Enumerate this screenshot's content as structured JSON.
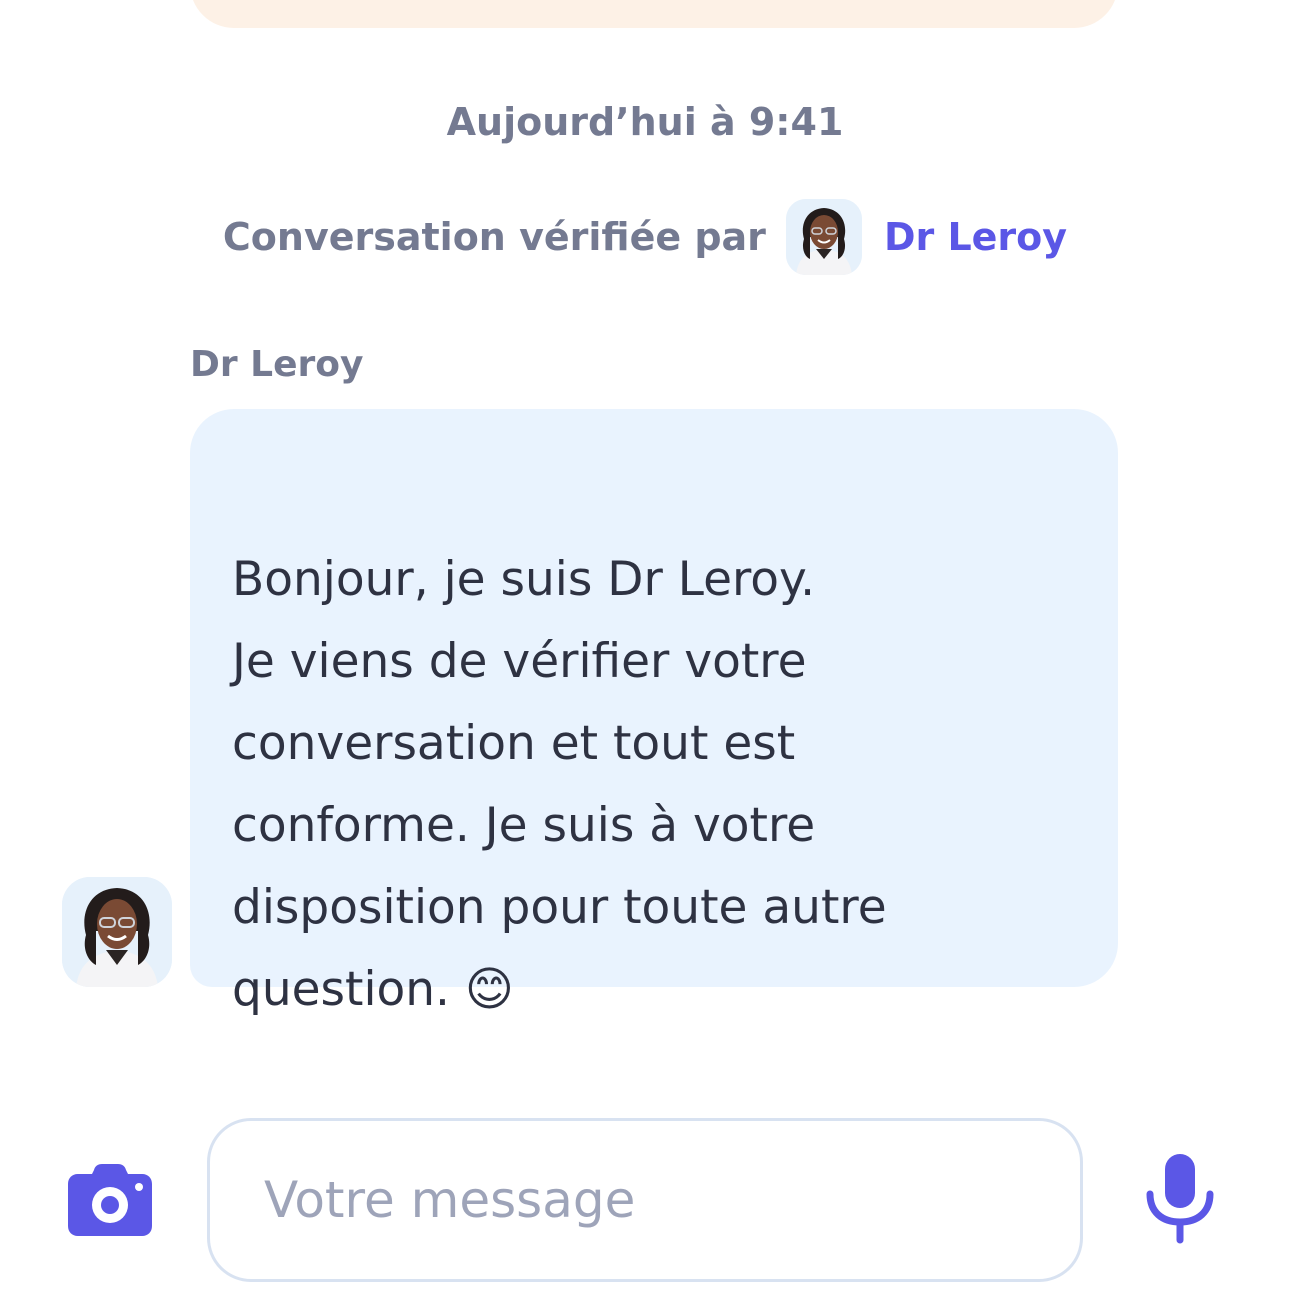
{
  "chat": {
    "timestamp": "Aujourd’hui à 9:41",
    "verified_label": "Conversation vérifiée par",
    "verified_by": "Dr Leroy",
    "sender_name": "Dr Leroy",
    "message_line1": "Bonjour, je suis Dr Leroy.",
    "message_body": "Je viens de vérifier votre\nconversation et tout est\nconforme. Je suis à votre\ndisposition pour toute autre\nquestion. 😊"
  },
  "composer": {
    "placeholder": "Votre message",
    "camera_icon": "camera-icon",
    "mic_icon": "microphone-icon"
  },
  "colors": {
    "accent": "#5b57e6",
    "bubble": "#e9f3fe",
    "top_card": "#fdf1e6",
    "muted_text": "#747a91"
  }
}
